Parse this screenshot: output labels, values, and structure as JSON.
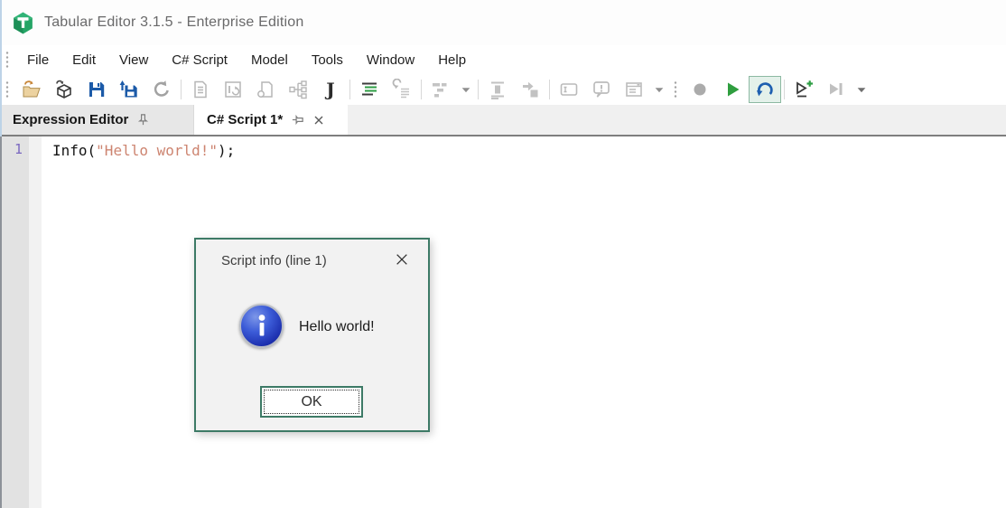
{
  "window": {
    "title": "Tabular Editor 3.1.5 - Enterprise Edition",
    "left_accent_color": "#bdd3e7"
  },
  "menu": {
    "items": [
      "File",
      "Edit",
      "View",
      "C# Script",
      "Model",
      "Tools",
      "Window",
      "Help"
    ]
  },
  "toolbar": {
    "buttons": [
      {
        "icon": "open-file-icon",
        "enabled": true
      },
      {
        "icon": "open-model-icon",
        "enabled": true
      },
      {
        "icon": "save-icon",
        "enabled": true
      },
      {
        "icon": "save-all-icon",
        "enabled": true
      },
      {
        "icon": "refresh-icon",
        "enabled": false
      },
      {
        "icon": "document-icon",
        "enabled": false
      },
      {
        "icon": "script-window-icon",
        "enabled": false
      },
      {
        "icon": "copy-page-icon",
        "enabled": false
      },
      {
        "icon": "hierarchy-icon",
        "enabled": false
      },
      {
        "icon": "csharp-script-icon",
        "enabled": true
      },
      {
        "icon": "format-document-icon",
        "enabled": true
      },
      {
        "icon": "format-undo-icon",
        "enabled": false
      },
      {
        "icon": "layout-blocks-icon",
        "enabled": false
      },
      {
        "icon": "dropdown-icon",
        "enabled": false
      },
      {
        "icon": "insert-column-icon",
        "enabled": false
      },
      {
        "icon": "goto-icon",
        "enabled": false
      },
      {
        "icon": "selection-box-icon",
        "enabled": false
      },
      {
        "icon": "message-bubble-icon",
        "enabled": false
      },
      {
        "icon": "output-window-icon",
        "enabled": false
      },
      {
        "icon": "dropdown-icon",
        "enabled": false
      },
      {
        "icon": "record-icon",
        "enabled": false
      },
      {
        "icon": "run-icon",
        "enabled": true
      },
      {
        "icon": "undo-last-icon",
        "enabled": true,
        "highlighted": true
      },
      {
        "icon": "run-new-icon",
        "enabled": true
      },
      {
        "icon": "run-to-end-icon",
        "enabled": false
      },
      {
        "icon": "dropdown-icon",
        "enabled": true
      }
    ]
  },
  "tabs": {
    "items": [
      {
        "label": "Expression Editor",
        "active": false,
        "pinned": false
      },
      {
        "label": "C# Script 1*",
        "active": true,
        "pinned": true,
        "closable": true
      }
    ]
  },
  "editor": {
    "lines": [
      {
        "number": "1",
        "tokens": [
          {
            "text": "Info(",
            "style": "code"
          },
          {
            "text": "\"Hello world!\"",
            "style": "string"
          },
          {
            "text": ");",
            "style": "code"
          }
        ]
      }
    ]
  },
  "dialog": {
    "title": "Script info (line 1)",
    "message": "Hello world!",
    "ok_label": "OK",
    "icon": "info-icon"
  },
  "colors": {
    "run_green": "#2f9e3f",
    "save_blue": "#1b5aa8",
    "dialog_border": "#3d7a66",
    "string_token": "#cd8470",
    "line_number": "#7a68c0",
    "tabstrip_border": "#7e7e7e"
  }
}
